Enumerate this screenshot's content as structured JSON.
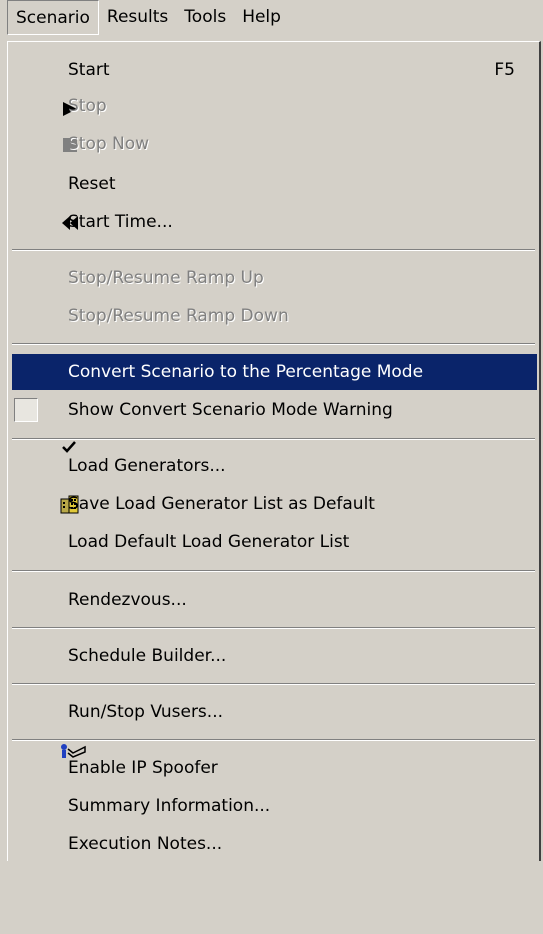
{
  "menubar": {
    "items": [
      "Scenario",
      "Results",
      "Tools",
      "Help"
    ]
  },
  "menu": {
    "start": {
      "label": "Start",
      "shortcut": "F5"
    },
    "stop": "Stop",
    "stop_now": "Stop Now",
    "reset": "Reset",
    "start_time": "Start Time...",
    "stop_resume_ramp_up": "Stop/Resume Ramp Up",
    "stop_resume_ramp_down": "Stop/Resume Ramp Down",
    "convert_scenario": "Convert Scenario to the Percentage Mode",
    "show_convert_warning": "Show Convert Scenario Mode Warning",
    "load_generators": "Load Generators...",
    "save_load_generator_list": "Save Load Generator List as Default",
    "load_default_generator_list": "Load Default Load Generator List",
    "rendezvous": "Rendezvous...",
    "schedule_builder": "Schedule Builder...",
    "run_stop_vusers": "Run/Stop Vusers...",
    "enable_ip_spoofer": "Enable IP Spoofer",
    "summary_information": "Summary Information...",
    "execution_notes": "Execution Notes..."
  },
  "state": {
    "highlighted_item": "convert_scenario",
    "show_convert_warning_checked": true
  },
  "colors": {
    "menu_bg": "#d4d0c8",
    "highlight": "#0a246a",
    "disabled_text": "#808080"
  },
  "icons": {
    "start": "play-icon",
    "stop": "stop-square-icon",
    "reset": "rewind-icon",
    "show_convert_warning": "checkmark-icon",
    "load_generators": "building-icon",
    "run_stop_vusers": "vuser-run-icon"
  }
}
